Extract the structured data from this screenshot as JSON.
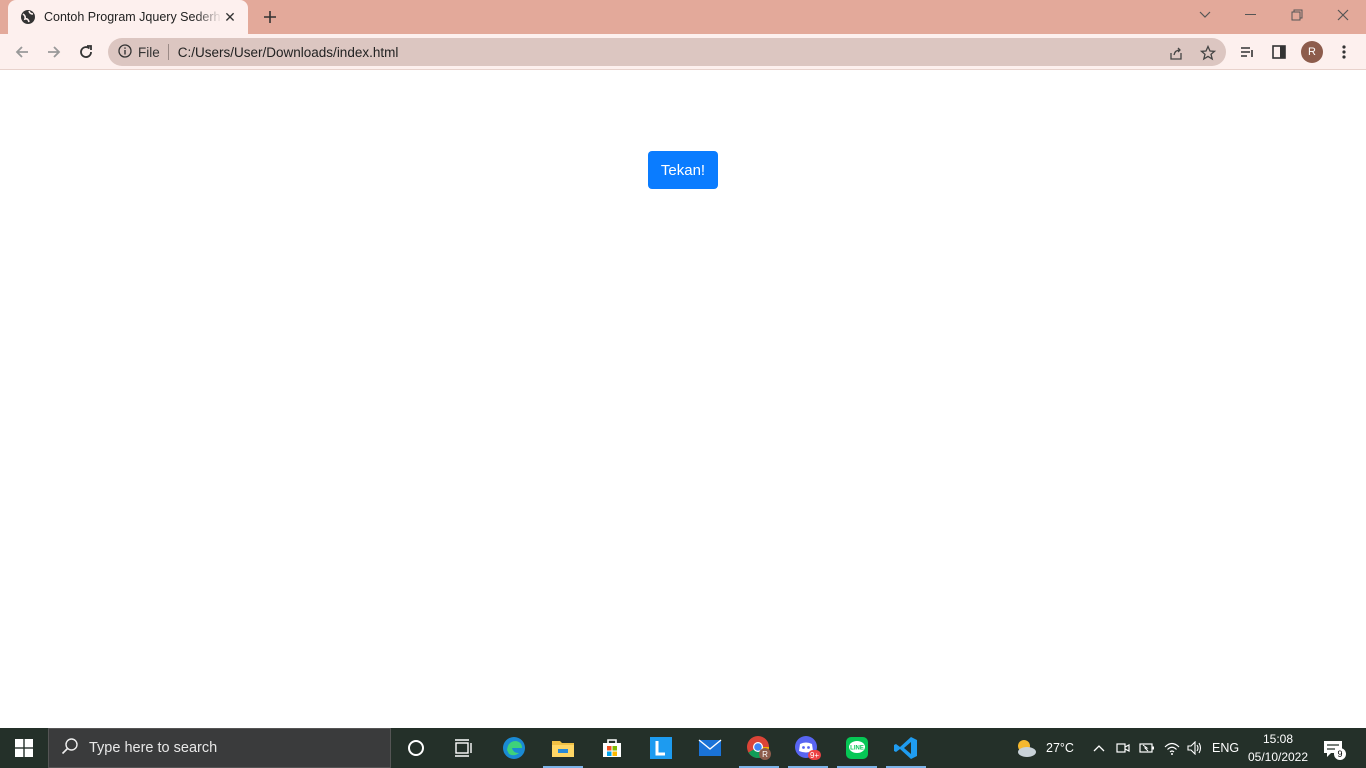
{
  "browser": {
    "tab": {
      "title": "Contoh Program Jquery Sederhana"
    },
    "omnibox": {
      "site_label": "File",
      "url": "C:/Users/User/Downloads/index.html"
    },
    "profile_initial": "R"
  },
  "page": {
    "button_label": "Tekan!"
  },
  "taskbar": {
    "search_placeholder": "Type here to search",
    "weather": "27°C",
    "language": "ENG",
    "time": "15:08",
    "date": "05/10/2022",
    "notification_count": "9",
    "discord_badge": "9+"
  },
  "colors": {
    "tabstrip": "#e3a99a",
    "toolbar": "#fdf0ee",
    "button": "#0a7cff",
    "taskbar": "#243029"
  }
}
